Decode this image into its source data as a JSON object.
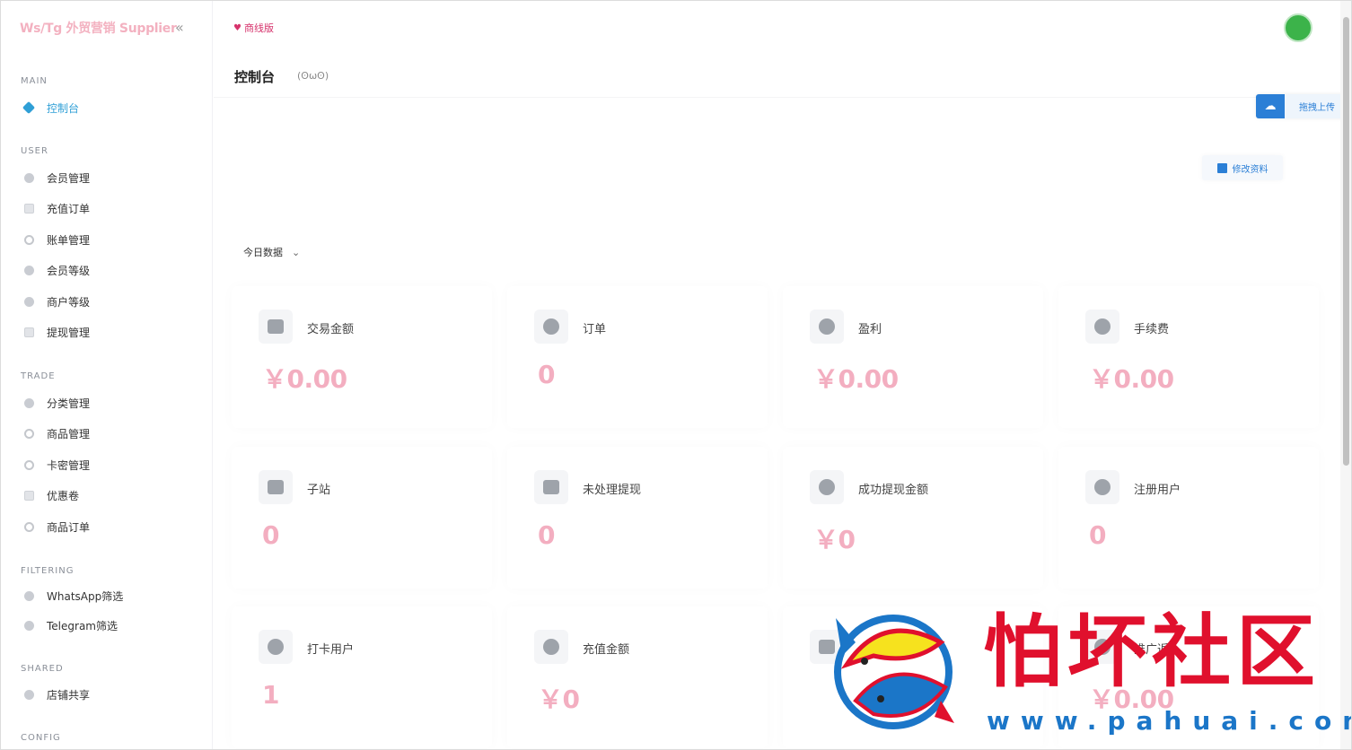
{
  "brand": "Ws/Tg 外贸营销 Supplier",
  "edition": "商线版",
  "page_title": "控制台",
  "page_subtitle": "(ʘωʘ)",
  "upload_label": "拖拽上传",
  "edit_profile_label": "修改资料",
  "range_select": "今日数据",
  "sidebar": {
    "sections": {
      "main": "MAIN",
      "user": "USER",
      "trade": "TRADE",
      "filtering": "FILTERING",
      "shared": "SHARED",
      "config": "CONFIG"
    },
    "items": [
      {
        "label": "控制台",
        "icon": "dashboard-icon"
      },
      {
        "label": "会员管理",
        "icon": "user-icon"
      },
      {
        "label": "充值订单",
        "icon": "recharge-icon"
      },
      {
        "label": "账单管理",
        "icon": "bill-icon"
      },
      {
        "label": "会员等级",
        "icon": "level-icon"
      },
      {
        "label": "商户等级",
        "icon": "merchant-icon"
      },
      {
        "label": "提现管理",
        "icon": "withdraw-icon"
      },
      {
        "label": "分类管理",
        "icon": "category-icon"
      },
      {
        "label": "商品管理",
        "icon": "goods-icon"
      },
      {
        "label": "卡密管理",
        "icon": "card-key-icon"
      },
      {
        "label": "优惠卷",
        "icon": "coupon-icon"
      },
      {
        "label": "商品订单",
        "icon": "order-icon"
      },
      {
        "label": "WhatsApp筛选",
        "icon": "whatsapp-icon"
      },
      {
        "label": "Telegram筛选",
        "icon": "telegram-icon"
      },
      {
        "label": "店铺共享",
        "icon": "share-icon"
      }
    ]
  },
  "stats": [
    {
      "label": "交易金额",
      "value": "￥0.00",
      "icon": "bag-icon"
    },
    {
      "label": "订单",
      "value": "0",
      "icon": "pie-chart-icon"
    },
    {
      "label": "盈利",
      "value": "￥0.00",
      "icon": "pie-chart-icon"
    },
    {
      "label": "手续费",
      "value": "￥0.00",
      "icon": "dollar-hand-icon"
    },
    {
      "label": "子站",
      "value": "0",
      "icon": "house-icon"
    },
    {
      "label": "未处理提现",
      "value": "0",
      "icon": "dollar-card-icon"
    },
    {
      "label": "成功提现金额",
      "value": "￥0",
      "icon": "funnel-dollar-icon"
    },
    {
      "label": "注册用户",
      "value": "0",
      "icon": "user-plus-icon"
    },
    {
      "label": "打卡用户",
      "value": "1",
      "icon": "clock-icon"
    },
    {
      "label": "充值金额",
      "value": "￥0",
      "icon": "hand-dollar-icon"
    },
    {
      "label": "",
      "value": "",
      "icon": "paypal-icon"
    },
    {
      "label": "推广返",
      "value": "￥0.00",
      "icon": "yen-icon"
    }
  ],
  "watermark": {
    "text": "怕坏社区",
    "url": "www.pahuai.com"
  },
  "colors": {
    "accent": "#2f9fd6",
    "value_pink": "#f3aec0",
    "edition_red": "#d6336c",
    "watermark_red": "#e0102d",
    "watermark_blue": "#1b76c8"
  }
}
